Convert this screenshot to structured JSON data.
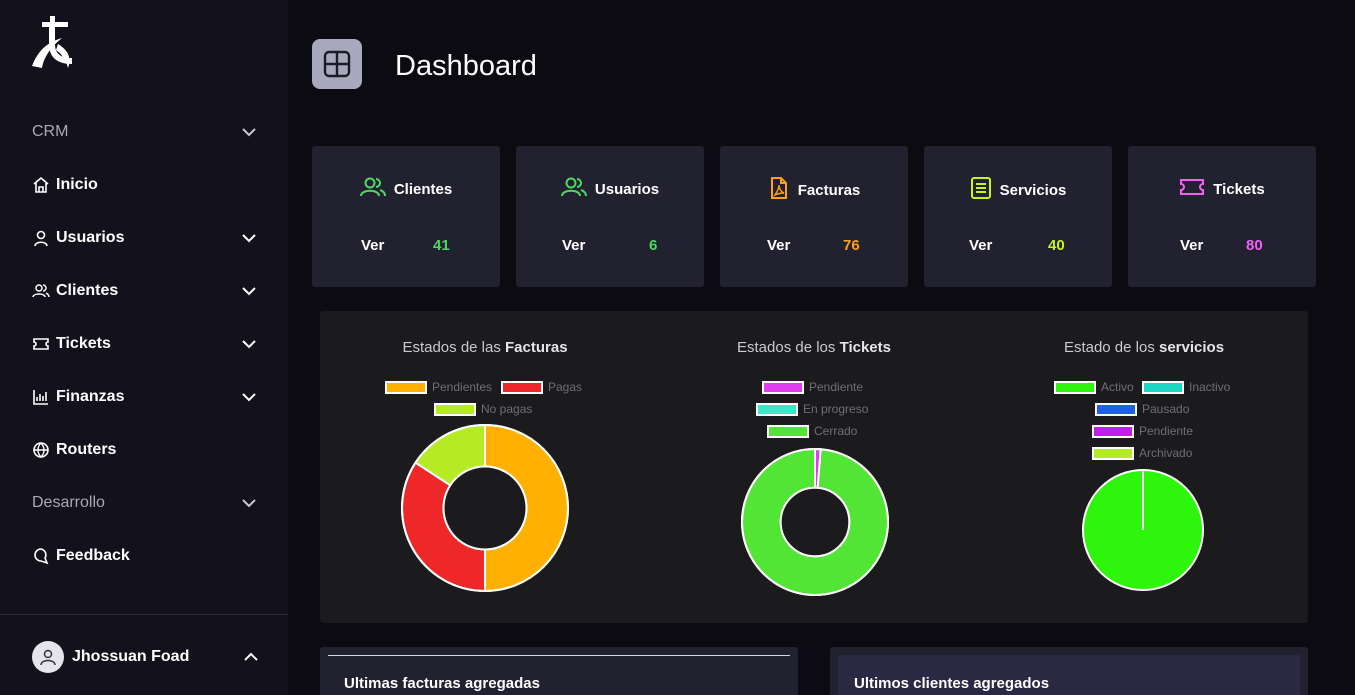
{
  "sidebar": {
    "items": [
      {
        "label": "CRM"
      },
      {
        "label": "Inicio"
      },
      {
        "label": "Usuarios"
      },
      {
        "label": "Clientes"
      },
      {
        "label": "Tickets"
      },
      {
        "label": "Finanzas"
      },
      {
        "label": "Routers"
      },
      {
        "label": "Desarrollo"
      },
      {
        "label": "Feedback"
      }
    ],
    "user": {
      "name": "Jhossuan Foad"
    }
  },
  "header": {
    "title": "Dashboard"
  },
  "cards": [
    {
      "label": "Clientes",
      "ver": "Ver",
      "count": "41",
      "color": "#4cd964"
    },
    {
      "label": "Usuarios",
      "ver": "Ver",
      "count": "6",
      "color": "#4cd964"
    },
    {
      "label": "Facturas",
      "ver": "Ver",
      "count": "76",
      "color": "#ff9f1a"
    },
    {
      "label": "Servicios",
      "ver": "Ver",
      "count": "40",
      "color": "#c6f520"
    },
    {
      "label": "Tickets",
      "ver": "Ver",
      "count": "80",
      "color": "#f062f5"
    }
  ],
  "charts": [
    {
      "title_prefix": "Estados de las ",
      "title_bold": "Facturas"
    },
    {
      "title_prefix": "Estados de los ",
      "title_bold": "Tickets"
    },
    {
      "title_prefix": "Estado de los ",
      "title_bold": "servicios"
    }
  ],
  "chart_data": [
    {
      "type": "pie",
      "title": "Estados de las Facturas",
      "donut": true,
      "categories": [
        "Pendientes",
        "Pagas",
        "No pagas"
      ],
      "values": [
        38,
        26,
        12
      ],
      "colors": [
        "#ffb000",
        "#ee2828",
        "#b5eb25"
      ]
    },
    {
      "type": "pie",
      "title": "Estados de los Tickets",
      "donut": true,
      "categories": [
        "Pendiente",
        "En progreso",
        "Cerrado"
      ],
      "values": [
        1,
        0,
        79
      ],
      "colors": [
        "#e23cf0",
        "#3ee6c8",
        "#52e536"
      ]
    },
    {
      "type": "pie",
      "title": "Estado de los servicios",
      "donut": false,
      "categories": [
        "Activo",
        "Inactivo",
        "Pausado",
        "Pendiente",
        "Archivado"
      ],
      "values": [
        40,
        0,
        0,
        0,
        0
      ],
      "colors": [
        "#2ef50c",
        "#1ed6c4",
        "#1e5ef0",
        "#c21ef0",
        "#b5eb25"
      ]
    }
  ],
  "panels": [
    {
      "title": "Ultimas facturas agregadas"
    },
    {
      "title": "Ultimos clientes agregados"
    }
  ]
}
